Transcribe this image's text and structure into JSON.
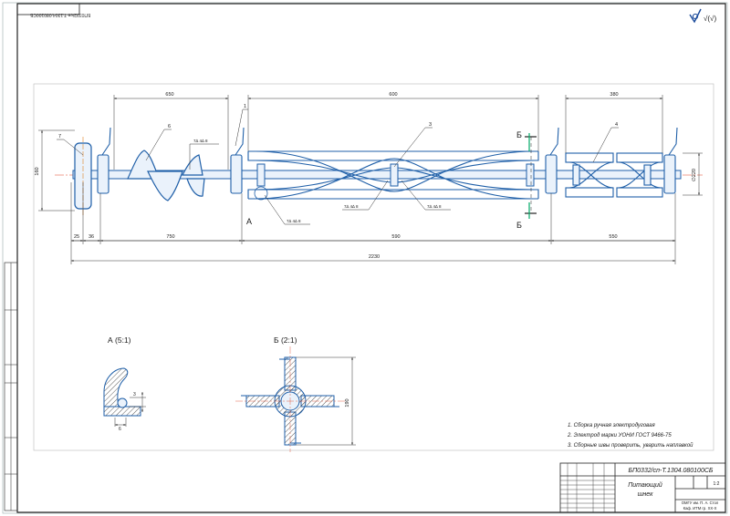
{
  "frame_stamp": "БП0332/сп-Т.1304.080100СБ",
  "roughness_symbol": "√(√)",
  "dimensions": {
    "overall_length": "2230",
    "pitch_650": "650",
    "length_600": "600",
    "length_380": "380",
    "height_160": "160",
    "seg_25": "25",
    "seg_36": "36",
    "seg_750": "750",
    "seg_590": "590",
    "seg_550": "550",
    "section_height": "190",
    "detail_dim": "3",
    "small_dim": "6",
    "right_dim": "∅220"
  },
  "welds": [
    "7∆ 4∆ 8",
    "7∆ 4∆ 8",
    "7∆ 4∆ 8",
    "7∆ 4∆ 8"
  ],
  "positions": [
    "7",
    "6",
    "1",
    "3",
    "4"
  ],
  "sections": {
    "a_marker": "А",
    "b_marker_top": "Б",
    "b_marker_bottom": "Б",
    "a_title": "А (5:1)",
    "b_title": "Б (2:1)"
  },
  "notes": [
    "1. Сборка ручная электродуговая",
    "2. Электрод марки УОНИ ГОСТ 9466-75",
    "3. Сборные швы проверить, уварить наплавкой"
  ],
  "title_block": {
    "doc_code": "БП0332/сп-Т.1304.080100СБ",
    "name_line1": "Питающий",
    "name_line2": "шнек",
    "scale": "1:2",
    "org_line1": "ОМГУ им. П. А. Стол",
    "org_line2": "Каф. ИТМ гр. ХХ-Х"
  }
}
